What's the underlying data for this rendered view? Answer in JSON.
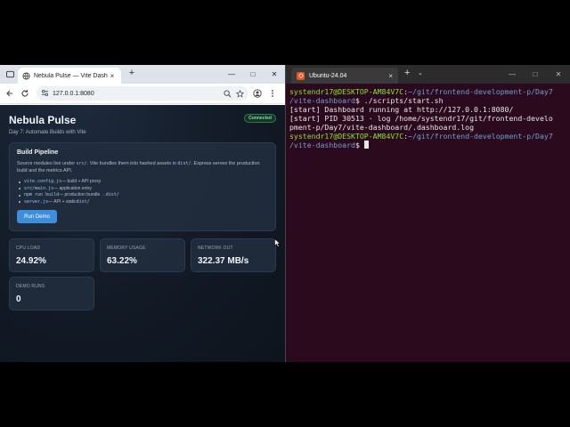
{
  "browser": {
    "tab_title": "Nebula Pulse — Vite Dashboard",
    "tab_close": "×",
    "new_tab": "+",
    "url": "127.0.0.1:8080",
    "window_controls": {
      "minimize": "—",
      "maximize": "□",
      "close": "✕"
    }
  },
  "page": {
    "title": "Nebula Pulse",
    "subtitle": "Day 7: Automate Builds with Vite",
    "status": "Connected",
    "pipeline": {
      "title": "Build Pipeline",
      "desc_1": "Source modules live under ",
      "desc_code_1": "src/",
      "desc_2": ". Vite bundles them into hashed assets in ",
      "desc_code_2": "dist/",
      "desc_3": ". Express serves the production build and the metrics API.",
      "steps": [
        {
          "code": "vite.config.js",
          "text": " — build + API proxy"
        },
        {
          "code": "src/main.js",
          "text": " — application entry"
        },
        {
          "code": "npm run build",
          "text": " — production bundle → ",
          "code2": "dist/"
        },
        {
          "code": "server.js",
          "text": " — API + static ",
          "code2": "dist/"
        }
      ],
      "run_button": "Run Demo"
    },
    "metrics": [
      {
        "label": "CPU LOAD",
        "value": "24.92%"
      },
      {
        "label": "MEMORY USAGE",
        "value": "63.22%"
      },
      {
        "label": "NETWORK OUT",
        "value": "322.37 MB/s"
      },
      {
        "label": "DEMO RUNS",
        "value": "0"
      }
    ]
  },
  "terminal": {
    "tab_title": "Ubuntu-24.04",
    "tab_close": "×",
    "new_tab": "+",
    "dropdown": "⌄",
    "window_controls": {
      "minimize": "—",
      "maximize": "□",
      "close": "✕"
    },
    "lines": [
      {
        "user": "systendr17@DESKTOP-AM84V7C",
        "sep": ":",
        "path": "~/git/frontend-development-p/Day7",
        "text": ""
      },
      {
        "user": "",
        "sep": "",
        "path": "/vite-dashboard",
        "text": "$ ./scripts/start.sh"
      },
      {
        "user": "",
        "sep": "",
        "path": "",
        "text": "[start] Dashboard running at http://127.0.0.1:8080/"
      },
      {
        "user": "",
        "sep": "",
        "path": "",
        "text": "[start] PID 30513 · log /home/systendr17/git/frontend-develo"
      },
      {
        "user": "",
        "sep": "",
        "path": "",
        "text": "pment-p/Day7/vite-dashboard/.dashboard.log"
      },
      {
        "user": "systendr17@DESKTOP-AM84V7C",
        "sep": ":",
        "path": "~/git/frontend-development-p/Day7",
        "text": ""
      },
      {
        "user": "",
        "sep": "",
        "path": "/vite-dashboard",
        "text": "$ "
      }
    ]
  },
  "colors": {
    "accent": "#3e8ede",
    "status_green": "#7fe0a3",
    "terminal_bg": "#2b0a1e",
    "prompt_user": "#8ae234",
    "prompt_path": "#729fcf"
  }
}
